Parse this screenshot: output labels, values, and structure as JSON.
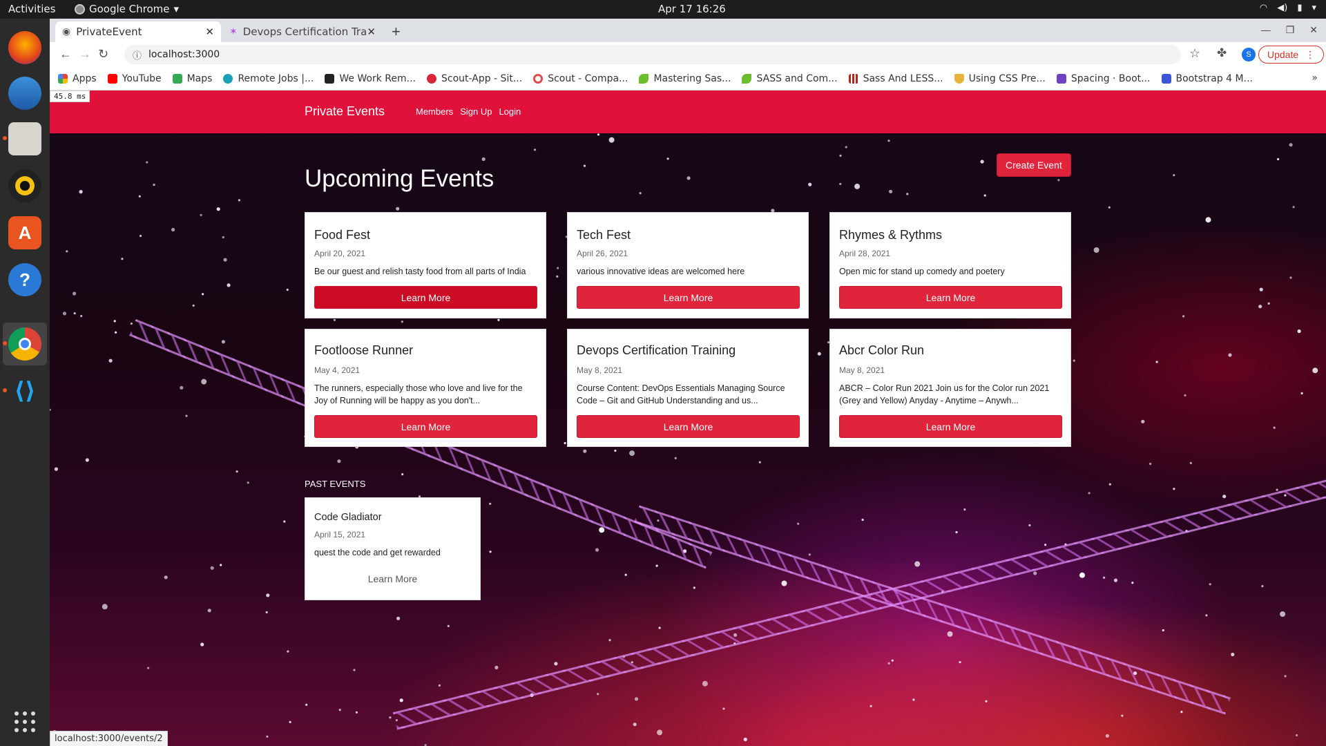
{
  "os": {
    "activities": "Activities",
    "app_name": "Google Chrome",
    "clock": "Apr 17  16:26"
  },
  "browser": {
    "tabs": [
      {
        "label": "PrivateEvent",
        "active": true
      },
      {
        "label": "Devops Certification Trai",
        "active": false
      }
    ],
    "url": "localhost:3000",
    "update_label": "Update",
    "profile_initial": "S",
    "bookmarks": [
      {
        "label": "Apps",
        "color": "#4285f4"
      },
      {
        "label": "YouTube",
        "color": "#ff0000"
      },
      {
        "label": "Maps",
        "color": "#34a853"
      },
      {
        "label": "Remote Jobs |...",
        "color": "#1aa1b9"
      },
      {
        "label": "We Work Rem...",
        "color": "#222222"
      },
      {
        "label": "Scout-App - Sit...",
        "color": "#d9263a"
      },
      {
        "label": "Scout - Compa...",
        "color": "#e04b4b"
      },
      {
        "label": "Mastering Sas...",
        "color": "#6abf2a"
      },
      {
        "label": "SASS and Com...",
        "color": "#6abf2a"
      },
      {
        "label": "Sass And LESS...",
        "color": "#b3261e"
      },
      {
        "label": "Using CSS Pre...",
        "color": "#e8b33a"
      },
      {
        "label": "Spacing · Boot...",
        "color": "#6f42c1"
      },
      {
        "label": "Bootstrap 4 M...",
        "color": "#3a56d4"
      }
    ],
    "status_url": "localhost:3000/events/2",
    "perf_badge": "45.8 ms"
  },
  "site": {
    "brand": "Private Events",
    "nav": [
      "Members",
      "Sign Up",
      "Login"
    ],
    "heading": "Upcoming Events",
    "create_label": "Create Event",
    "upcoming": [
      {
        "title": "Food Fest",
        "date": "April 20, 2021",
        "desc": "Be our guest and relish tasty food from all parts of India",
        "button": "Learn More"
      },
      {
        "title": "Tech Fest",
        "date": "April 26, 2021",
        "desc": "various innovative ideas are welcomed here",
        "button": "Learn More"
      },
      {
        "title": "Rhymes & Rythms",
        "date": "April 28, 2021",
        "desc": "Open mic for stand up comedy and poetery",
        "button": "Learn More"
      },
      {
        "title": "Footloose Runner",
        "date": "May 4, 2021",
        "desc": "The runners, especially those who love and live for the Joy of Running will be happy as you don't...",
        "button": "Learn More"
      },
      {
        "title": "Devops Certification Training",
        "date": "May 8, 2021",
        "desc": "Course Content: DevOps Essentials Managing Source Code – Git and GitHub Understanding and us...",
        "button": "Learn More"
      },
      {
        "title": "Abcr Color Run",
        "date": "May 8, 2021",
        "desc": "ABCR – Color Run 2021 Join us for the Color run 2021 (Grey and Yellow) Anyday - Anytime – Anywh...",
        "button": "Learn More"
      }
    ],
    "past_heading": "PAST EVENTS",
    "past": [
      {
        "title": "Code Gladiator",
        "date": "April 15, 2021",
        "desc": "quest the code and get rewarded",
        "button": "Learn More"
      }
    ]
  }
}
